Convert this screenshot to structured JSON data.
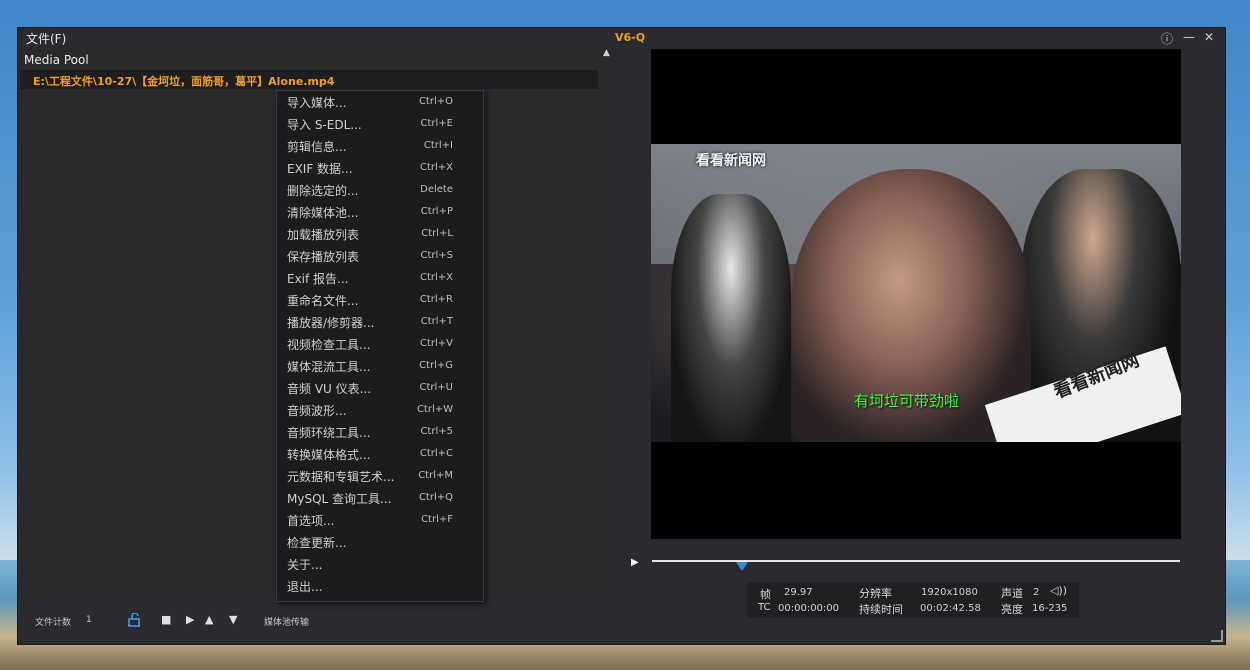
{
  "window": {
    "menu_file": "文件(F)",
    "title": "V6-Q",
    "buttons": [
      "ⓘ",
      "—",
      "✕"
    ]
  },
  "media_pool": {
    "title": "Media Pool",
    "items": [
      "E:\\工程文件\\10-27\\【金坷垃，面筋哥，葛平】Alone.mp4"
    ]
  },
  "context_menu": {
    "items": [
      {
        "label": "导入媒体...",
        "shortcut": "Ctrl+O"
      },
      {
        "label": "导入 S-EDL...",
        "shortcut": "Ctrl+E"
      },
      {
        "label": "剪辑信息...",
        "shortcut": "Ctrl+I"
      },
      {
        "label": "EXIF 数据...",
        "shortcut": "Ctrl+X"
      },
      {
        "label": "删除选定的...",
        "shortcut": "Delete"
      },
      {
        "label": "清除媒体池...",
        "shortcut": "Ctrl+P"
      },
      {
        "label": "加载播放列表",
        "shortcut": "Ctrl+L"
      },
      {
        "label": "保存播放列表",
        "shortcut": "Ctrl+S"
      },
      {
        "label": "Exif 报告...",
        "shortcut": "Ctrl+X"
      },
      {
        "label": "重命名文件...",
        "shortcut": "Ctrl+R"
      },
      {
        "label": "播放器/修剪器...",
        "shortcut": "Ctrl+T"
      },
      {
        "label": "视频检查工具...",
        "shortcut": "Ctrl+V"
      },
      {
        "label": "媒体混流工具...",
        "shortcut": "Ctrl+G"
      },
      {
        "label": "音频 VU 仪表...",
        "shortcut": "Ctrl+U"
      },
      {
        "label": "音频波形...",
        "shortcut": "Ctrl+W"
      },
      {
        "label": "音频环绕工具...",
        "shortcut": "Ctrl+5"
      },
      {
        "label": "转换媒体格式...",
        "shortcut": "Ctrl+C"
      },
      {
        "label": "元数据和专辑艺术...",
        "shortcut": "Ctrl+M"
      },
      {
        "label": "MySQL 查询工具...",
        "shortcut": "Ctrl+Q"
      },
      {
        "label": "首选项...",
        "shortcut": "Ctrl+F"
      },
      {
        "label": "检查更新...",
        "shortcut": ""
      },
      {
        "label": "关于...",
        "shortcut": ""
      },
      {
        "label": "退出...",
        "shortcut": ""
      }
    ]
  },
  "bottom_bar": {
    "file_count_label": "文件计数",
    "file_count": "1",
    "pool_transfer_label": "媒体池传输",
    "icons": [
      "unlock-icon",
      "stop-icon",
      "play-icon",
      "up-icon",
      "down-icon"
    ]
  },
  "video": {
    "logo_text": "看看新闻网",
    "caption": "有坷垃可带劲啦",
    "mic_text": "看看新闻网"
  },
  "playback": {
    "progress": 0.17
  },
  "info": {
    "fps_label": "帧",
    "fps_value": "29.97",
    "tc_label": "TC",
    "tc_value": "00:00:00:00",
    "resolution_label": "分辨率",
    "resolution_value": "1920x1080",
    "duration_label": "持续时间",
    "duration_value": "00:02:42.58",
    "channels_label": "声道",
    "channels_value": "2",
    "brightness_label": "亮度",
    "brightness_value": "16-235"
  },
  "colors": {
    "accent": "#f0a020",
    "seek_knob": "#2a8de0",
    "caption": "#35ff35"
  }
}
